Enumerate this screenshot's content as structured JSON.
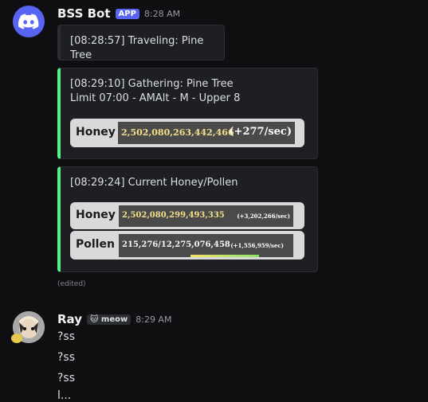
{
  "bot": {
    "name": "BSS Bot",
    "badge": "APP",
    "time": "8:28 AM",
    "embeds": [
      {
        "text": "[08:28:57] Traveling: Pine Tree"
      },
      {
        "line1": "[08:29:10] Gathering: Pine Tree",
        "line2": "Limit 07:00 - AMAlt - M - Upper 8",
        "stat": {
          "label": "Honey",
          "value": "2,502,080,263,442,466",
          "rate": "(+277/sec)"
        }
      },
      {
        "title": "[08:29:24] Current Honey/Pollen",
        "honey": {
          "label": "Honey",
          "value": "2,502,080,299,493,335",
          "rate": "(+3,202,266/sec)"
        },
        "pollen": {
          "label": "Pollen",
          "value": "215,276/12,275,076,458",
          "rate": "(+1,556,959/sec)",
          "progress": 0.0
        }
      }
    ],
    "edited": "(edited)"
  },
  "user": {
    "name": "Ray",
    "tag": "meow",
    "time": "8:29 AM",
    "messages": [
      "?ss",
      "?ss",
      "?ss",
      "l..."
    ]
  },
  "colors": {
    "accent": "#57f287",
    "brand": "#5865f2"
  }
}
